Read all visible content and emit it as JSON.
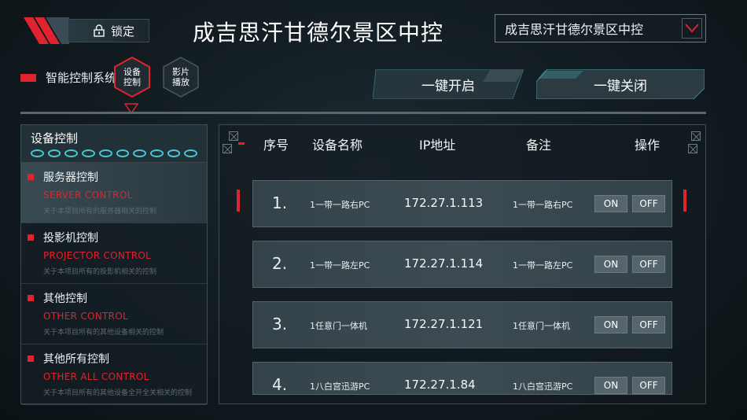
{
  "header": {
    "lock_label": "锁定",
    "title": "成吉思汗甘德尔景区中控",
    "dropdown_value": "成吉思汗甘德尔景区中控"
  },
  "nav": {
    "system_label": "智能控制系统",
    "tab_device": "设备控制",
    "tab_film": "影片播放",
    "all_on": "一键开启",
    "all_off": "一键关闭"
  },
  "sidebar": {
    "title": "设备控制",
    "items": [
      {
        "cn": "服务器控制",
        "en": "SERVER CONTROL",
        "desc": "关于本项目所有的服务器相关的控制"
      },
      {
        "cn": "投影机控制",
        "en": "PROJECTOR CONTROL",
        "desc": "关于本项目所有的投影机相关的控制"
      },
      {
        "cn": "其他控制",
        "en": "OTHER CONTROL",
        "desc": "关于本项目所有的其他设备相关的控制"
      },
      {
        "cn": "其他所有控制",
        "en": "OTHER ALL CONTROL",
        "desc": "关于本项目所有的其他设备全开全关相关的控制"
      }
    ]
  },
  "table": {
    "headers": {
      "no": "序号",
      "name": "设备名称",
      "ip": "IP地址",
      "remark": "备注",
      "action": "操作"
    },
    "rows": [
      {
        "no": "1.",
        "name": "1一带一路右PC",
        "ip": "172.27.1.113",
        "remark": "1一带一路右PC",
        "on": "ON",
        "off": "OFF"
      },
      {
        "no": "2.",
        "name": "1一带一路左PC",
        "ip": "172.27.1.114",
        "remark": "1一带一路左PC",
        "on": "ON",
        "off": "OFF"
      },
      {
        "no": "3.",
        "name": "1任意门一体机",
        "ip": "172.27.1.121",
        "remark": "1任意门一体机",
        "on": "ON",
        "off": "OFF"
      },
      {
        "no": "4.",
        "name": "1八白宫迅游PC",
        "ip": "172.27.1.84",
        "remark": "1八白宫迅游PC",
        "on": "ON",
        "off": "OFF"
      }
    ]
  },
  "colors": {
    "accent": "#e0242f",
    "teal": "#46c7d3"
  }
}
